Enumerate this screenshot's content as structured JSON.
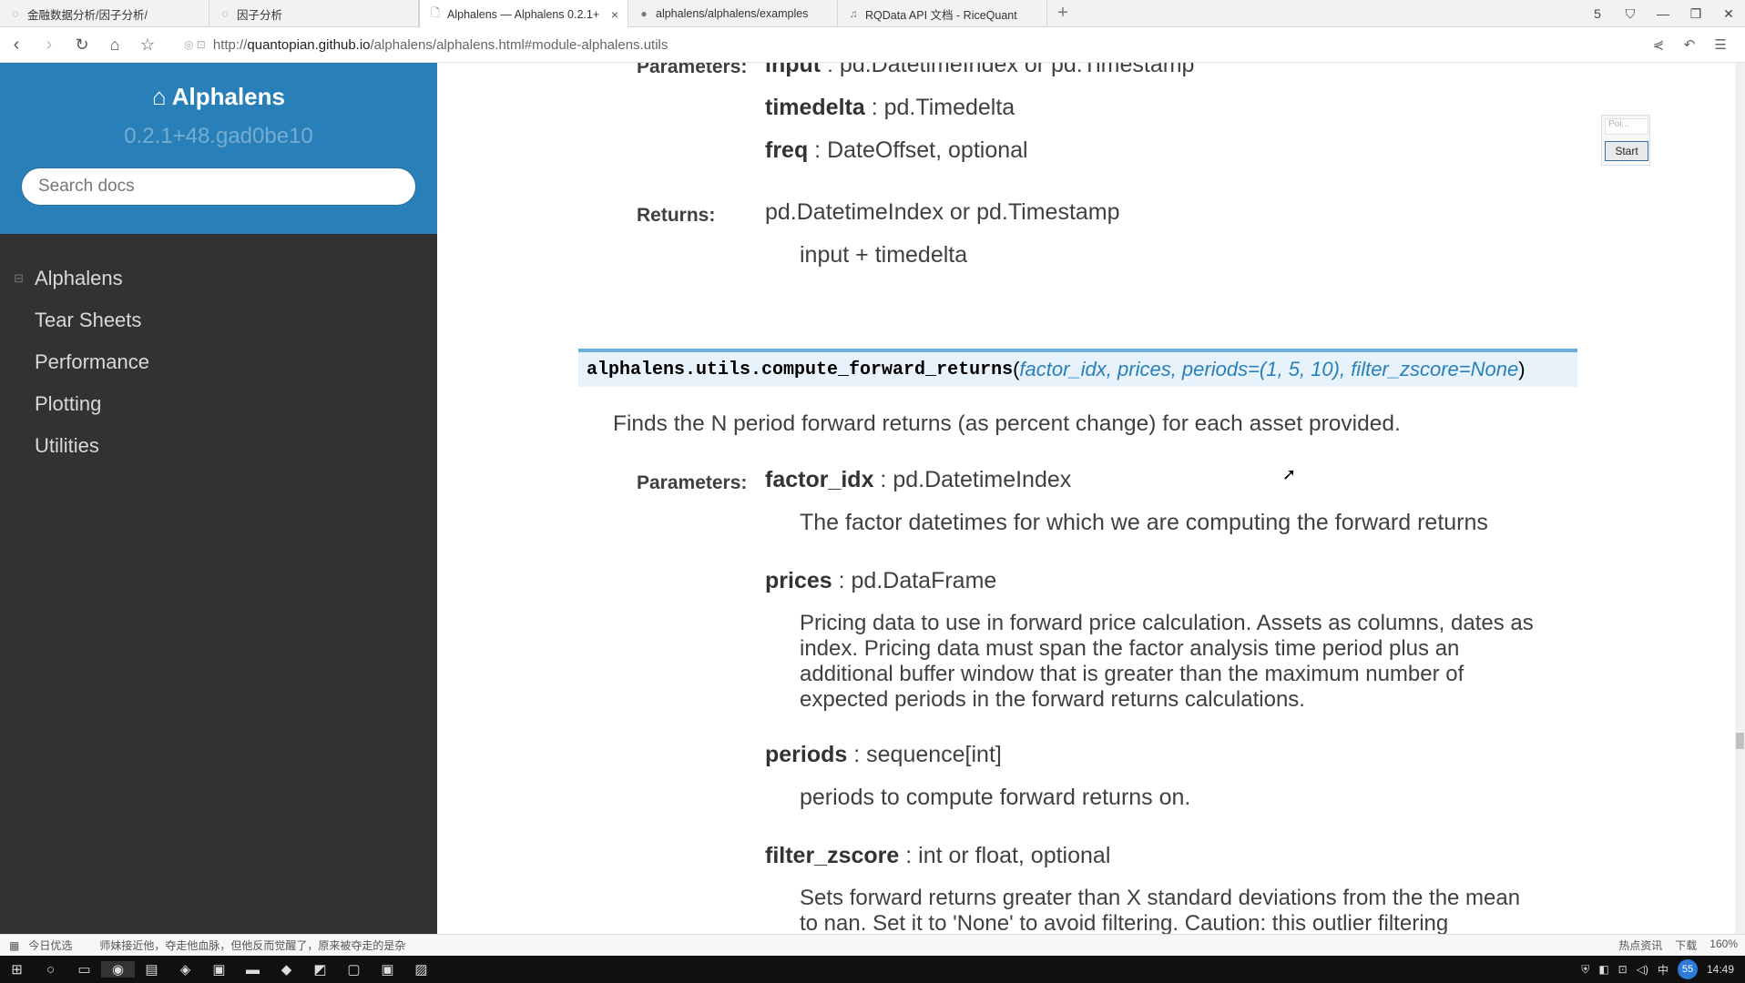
{
  "browser": {
    "tabs": [
      {
        "title": "金融数据分析/因子分析/",
        "icon": "loading-icon",
        "active": false
      },
      {
        "title": "因子分析",
        "icon": "loading-icon",
        "active": false
      },
      {
        "title": "Alphalens — Alphalens 0.2.1+",
        "icon": "page-icon",
        "active": true,
        "close": "×"
      },
      {
        "title": "alphalens/alphalens/examples",
        "icon": "github-icon",
        "active": false
      },
      {
        "title": "RQData API 文档 - RiceQuant",
        "icon": "bell-icon",
        "active": false
      }
    ],
    "new_tab": "+",
    "window_controls": [
      "5",
      "⛉",
      "—",
      "❐",
      "✕"
    ],
    "url_prefix": "http://",
    "url_host": "quantopian.github.io",
    "url_path": "/alphalens/alphalens.html#module-alphalens.utils"
  },
  "sidebar": {
    "brand": "Alphalens",
    "version": "0.2.1+48.gad0be10",
    "search_placeholder": "Search docs",
    "items": [
      {
        "label": "Alphalens",
        "toggle": "⊟"
      },
      {
        "label": "Tear Sheets"
      },
      {
        "label": "Performance"
      },
      {
        "label": "Plotting"
      },
      {
        "label": "Utilities"
      }
    ]
  },
  "prev_section": {
    "parameters_label": "Parameters:",
    "params": [
      {
        "name": "input",
        "type": " : pd.DatetimeIndex or pd.Timestamp"
      },
      {
        "name": "timedelta",
        "type": " : pd.Timedelta"
      },
      {
        "name": "freq",
        "type": " : DateOffset, optional"
      }
    ],
    "returns_label": "Returns:",
    "returns_type": "pd.DatetimeIndex or pd.Timestamp",
    "returns_desc": "input + timedelta"
  },
  "function": {
    "name": "alphalens.utils.compute_forward_returns",
    "open_paren": "(",
    "args": "factor_idx, prices, periods=(1, 5, 10), filter_zscore=None",
    "close_paren": ")",
    "summary": "Finds the N period forward returns (as percent change) for each asset provided.",
    "parameters_label": "Parameters:",
    "params": [
      {
        "name": "factor_idx",
        "type": " : pd.DatetimeIndex",
        "desc": "The factor datetimes for which we are computing the forward returns"
      },
      {
        "name": "prices",
        "type": " : pd.DataFrame",
        "desc_lines": [
          "Pricing data to use in forward price calculation. Assets as columns, dates as",
          "index. Pricing data must span the factor analysis time period plus an",
          "additional buffer window that is greater than the maximum number of",
          "expected periods in the forward returns calculations."
        ]
      },
      {
        "name": "periods",
        "type": " : sequence[int]",
        "desc": "periods to compute forward returns on."
      },
      {
        "name": "filter_zscore",
        "type": " : int or float, optional",
        "desc_lines": [
          "Sets forward returns greater than X standard deviations from the the mean",
          "to nan. Set it to 'None' to avoid filtering. Caution: this outlier filtering"
        ]
      }
    ]
  },
  "widget": {
    "input_placeholder": "Poi...",
    "start_label": "Start"
  },
  "statusbar": {
    "left": "今日优选",
    "headline": "师妹接近他，夺走他血脉，但他反而觉醒了，原来被夺走的是杂",
    "right": [
      "热点资讯",
      "下载",
      "160%"
    ]
  },
  "taskbar": {
    "time": "14:49",
    "badge": "55",
    "ime": "中"
  }
}
